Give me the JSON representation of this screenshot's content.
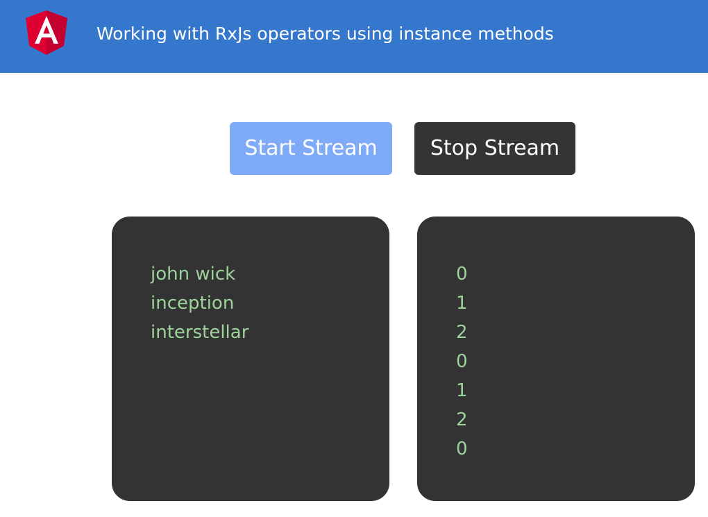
{
  "header": {
    "title": "Working with RxJs operators using instance methods",
    "logo_icon": "angular-logo-icon",
    "background_color": "#3577cc"
  },
  "controls": {
    "start_label": "Start Stream",
    "stop_label": "Stop Stream",
    "start_color": "#7faaf8",
    "stop_color": "#343434"
  },
  "movies_panel": {
    "items": [
      "john wick",
      "inception",
      "interstellar"
    ]
  },
  "index_panel": {
    "items": [
      "0",
      "1",
      "2",
      "0",
      "1",
      "2",
      "0"
    ]
  },
  "text_color": "#9dd39a",
  "panel_color": "#333333"
}
